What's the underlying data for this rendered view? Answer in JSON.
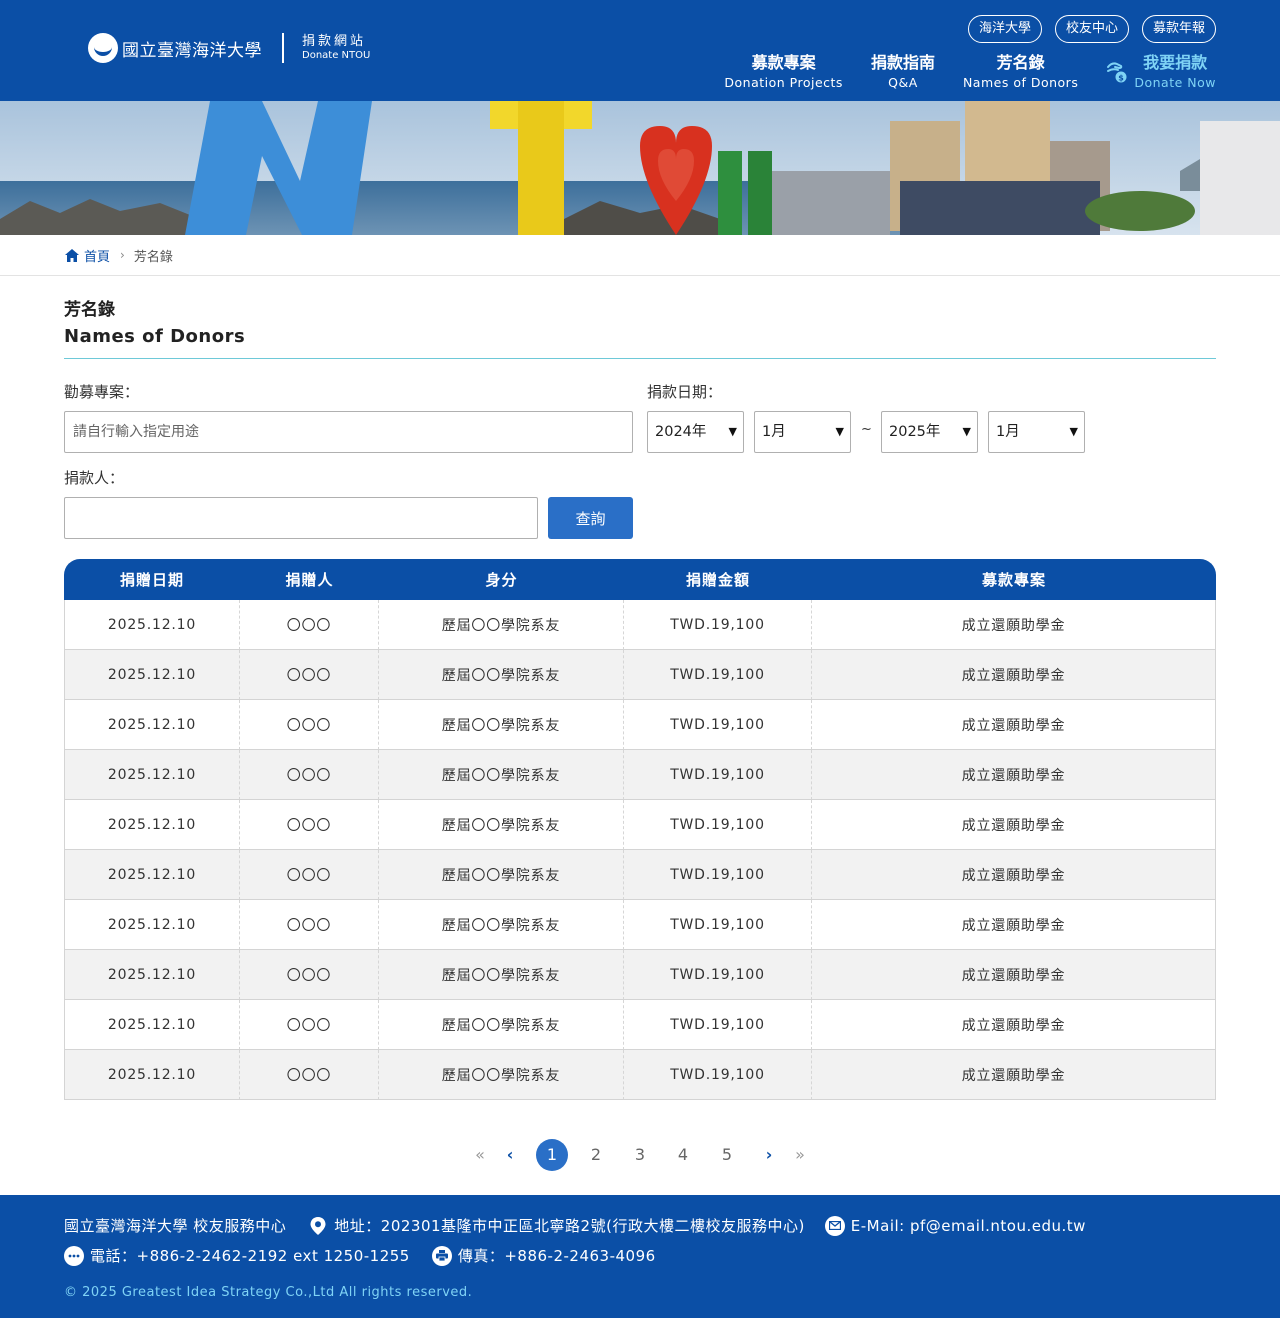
{
  "header": {
    "logo_name": "國立臺灣海洋大學",
    "site_zh": "捐款網站",
    "site_en": "Donate NTOU",
    "top_links": [
      "海洋大學",
      "校友中心",
      "募款年報"
    ],
    "nav": [
      {
        "zh": "募款專案",
        "en": "Donation Projects"
      },
      {
        "zh": "捐款指南",
        "en": "Q&A"
      },
      {
        "zh": "芳名錄",
        "en": "Names of Donors"
      }
    ],
    "donate": {
      "zh": "我要捐款",
      "en": "Donate Now"
    }
  },
  "banner": {
    "letters": [
      "N",
      "T",
      "U"
    ]
  },
  "breadcrumb": {
    "home": "首頁",
    "current": "芳名錄"
  },
  "title": {
    "zh": "芳名錄",
    "en": "Names of Donors"
  },
  "form": {
    "project_label": "勸募專案：",
    "project_placeholder": "請自行輸入指定用途",
    "date_label": "捐款日期：",
    "start_year": "2024年",
    "start_month": "1月",
    "tilde": "~",
    "end_year": "2025年",
    "end_month": "1月",
    "donor_label": "捐款人：",
    "donor_value": "",
    "query_button": "查詢"
  },
  "table": {
    "headers": [
      "捐贈日期",
      "捐贈人",
      "身分",
      "捐贈金額",
      "募款專案"
    ],
    "rows": [
      [
        "2025.12.10",
        "〇〇〇",
        "歷屆〇〇學院系友",
        "TWD.19,100",
        "成立還願助學金"
      ],
      [
        "2025.12.10",
        "〇〇〇",
        "歷屆〇〇學院系友",
        "TWD.19,100",
        "成立還願助學金"
      ],
      [
        "2025.12.10",
        "〇〇〇",
        "歷屆〇〇學院系友",
        "TWD.19,100",
        "成立還願助學金"
      ],
      [
        "2025.12.10",
        "〇〇〇",
        "歷屆〇〇學院系友",
        "TWD.19,100",
        "成立還願助學金"
      ],
      [
        "2025.12.10",
        "〇〇〇",
        "歷屆〇〇學院系友",
        "TWD.19,100",
        "成立還願助學金"
      ],
      [
        "2025.12.10",
        "〇〇〇",
        "歷屆〇〇學院系友",
        "TWD.19,100",
        "成立還願助學金"
      ],
      [
        "2025.12.10",
        "〇〇〇",
        "歷屆〇〇學院系友",
        "TWD.19,100",
        "成立還願助學金"
      ],
      [
        "2025.12.10",
        "〇〇〇",
        "歷屆〇〇學院系友",
        "TWD.19,100",
        "成立還願助學金"
      ],
      [
        "2025.12.10",
        "〇〇〇",
        "歷屆〇〇學院系友",
        "TWD.19,100",
        "成立還願助學金"
      ],
      [
        "2025.12.10",
        "〇〇〇",
        "歷屆〇〇學院系友",
        "TWD.19,100",
        "成立還願助學金"
      ]
    ]
  },
  "pagination": {
    "first": "«",
    "prev": "‹",
    "pages": [
      "1",
      "2",
      "3",
      "4",
      "5"
    ],
    "current": "1",
    "next": "›",
    "last": "»"
  },
  "footer": {
    "org": "國立臺灣海洋大學 校友服務中心",
    "address": "地址：202301基隆市中正區北寧路2號(行政大樓二樓校友服務中心)",
    "email": "E-Mail: pf@email.ntou.edu.tw",
    "phone": "電話：+886-2-2462-2192 ext 1250-1255",
    "fax": "傳真：+886-2-2463-4096",
    "copyright": "© 2025 Greatest Idea Strategy Co.,Ltd All rights reserved."
  },
  "colors": {
    "brand_blue": "#0b4fa6",
    "accent_cyan": "#7fd3f5",
    "button_blue": "#2a6fc7",
    "divider_teal": "#6ec9d8"
  },
  "icons": [
    "donate-hand-icon",
    "home-icon",
    "chevron-right-icon",
    "location-pin-icon",
    "mail-icon",
    "chat-phone-icon",
    "fax-printer-icon",
    "select-arrow-icon"
  ]
}
